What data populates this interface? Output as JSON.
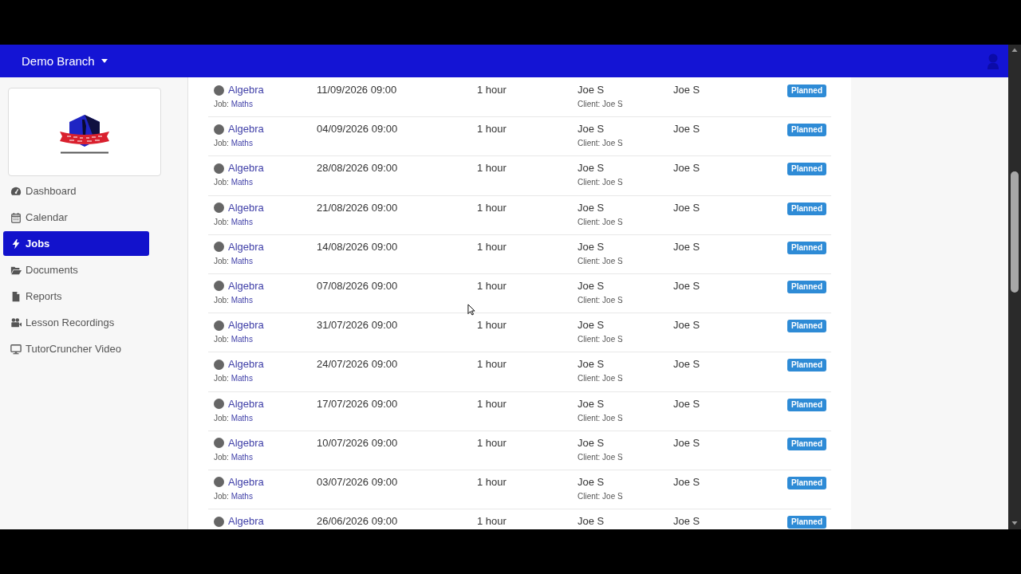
{
  "navbar": {
    "branch_menu": "Demo Branch"
  },
  "sidebar": {
    "items": [
      {
        "label": "Dashboard",
        "selected": false
      },
      {
        "label": "Calendar",
        "selected": false
      },
      {
        "label": "Jobs",
        "selected": true
      },
      {
        "label": "Documents",
        "selected": false
      },
      {
        "label": "Reports",
        "selected": false
      },
      {
        "label": "Lesson Recordings",
        "selected": false
      },
      {
        "label": "TutorCruncher Video",
        "selected": false
      }
    ]
  },
  "lessons": {
    "rows": [
      {
        "lesson": "Algebra",
        "job_label": "Job:",
        "job": "Maths",
        "start": "11/09/2026 09:00",
        "duration": "1 hour",
        "column_4": "Joe S",
        "client_line": "Client: Joe S",
        "column_5": "Joe S",
        "status": "Planned"
      },
      {
        "lesson": "Algebra",
        "job_label": "Job:",
        "job": "Maths",
        "start": "04/09/2026 09:00",
        "duration": "1 hour",
        "column_4": "Joe S",
        "client_line": "Client: Joe S",
        "column_5": "Joe S",
        "status": "Planned"
      },
      {
        "lesson": "Algebra",
        "job_label": "Job:",
        "job": "Maths",
        "start": "28/08/2026 09:00",
        "duration": "1 hour",
        "column_4": "Joe S",
        "client_line": "Client: Joe S",
        "column_5": "Joe S",
        "status": "Planned"
      },
      {
        "lesson": "Algebra",
        "job_label": "Job:",
        "job": "Maths",
        "start": "21/08/2026 09:00",
        "duration": "1 hour",
        "column_4": "Joe S",
        "client_line": "Client: Joe S",
        "column_5": "Joe S",
        "status": "Planned"
      },
      {
        "lesson": "Algebra",
        "job_label": "Job:",
        "job": "Maths",
        "start": "14/08/2026 09:00",
        "duration": "1 hour",
        "column_4": "Joe S",
        "client_line": "Client: Joe S",
        "column_5": "Joe S",
        "status": "Planned"
      },
      {
        "lesson": "Algebra",
        "job_label": "Job:",
        "job": "Maths",
        "start": "07/08/2026 09:00",
        "duration": "1 hour",
        "column_4": "Joe S",
        "client_line": "Client: Joe S",
        "column_5": "Joe S",
        "status": "Planned"
      },
      {
        "lesson": "Algebra",
        "job_label": "Job:",
        "job": "Maths",
        "start": "31/07/2026 09:00",
        "duration": "1 hour",
        "column_4": "Joe S",
        "client_line": "Client: Joe S",
        "column_5": "Joe S",
        "status": "Planned"
      },
      {
        "lesson": "Algebra",
        "job_label": "Job:",
        "job": "Maths",
        "start": "24/07/2026 09:00",
        "duration": "1 hour",
        "column_4": "Joe S",
        "client_line": "Client: Joe S",
        "column_5": "Joe S",
        "status": "Planned"
      },
      {
        "lesson": "Algebra",
        "job_label": "Job:",
        "job": "Maths",
        "start": "17/07/2026 09:00",
        "duration": "1 hour",
        "column_4": "Joe S",
        "client_line": "Client: Joe S",
        "column_5": "Joe S",
        "status": "Planned"
      },
      {
        "lesson": "Algebra",
        "job_label": "Job:",
        "job": "Maths",
        "start": "10/07/2026 09:00",
        "duration": "1 hour",
        "column_4": "Joe S",
        "client_line": "Client: Joe S",
        "column_5": "Joe S",
        "status": "Planned"
      },
      {
        "lesson": "Algebra",
        "job_label": "Job:",
        "job": "Maths",
        "start": "03/07/2026 09:00",
        "duration": "1 hour",
        "column_4": "Joe S",
        "client_line": "Client: Joe S",
        "column_5": "Joe S",
        "status": "Planned"
      },
      {
        "lesson": "Algebra",
        "start": "26/06/2026 09:00",
        "duration": "1 hour",
        "column_4": "Joe S",
        "column_5": "Joe S",
        "status": "Planned"
      }
    ]
  }
}
